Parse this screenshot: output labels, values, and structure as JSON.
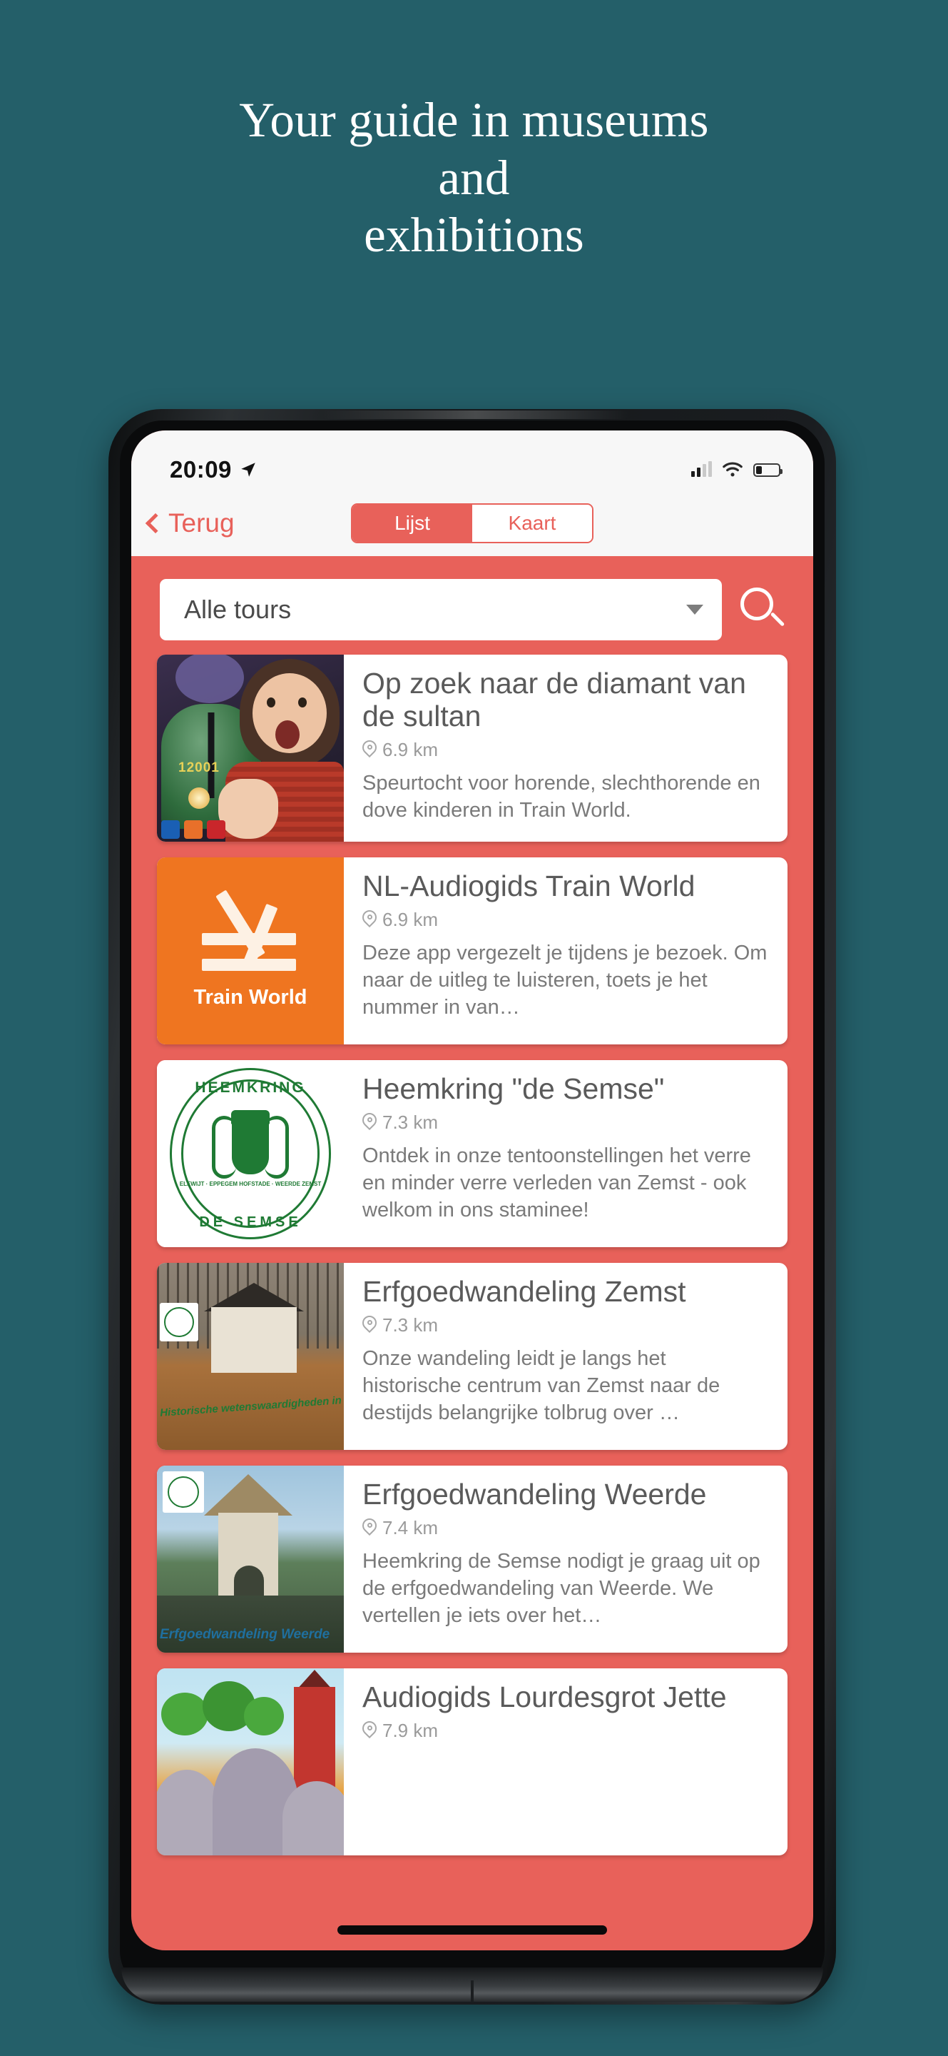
{
  "hero": {
    "line1": "Your guide in museums",
    "line2": "and",
    "line3": "exhibitions",
    "background_color": "#245f69",
    "text_color": "#ffffff"
  },
  "theme": {
    "accent_coral": "#e8615a",
    "teal": "#245f69",
    "orange": "#ef7520",
    "green": "#1f7a34"
  },
  "status_bar": {
    "time": "20:09",
    "location_icon": "location-arrow-icon",
    "signal_icon": "signal-bars-icon",
    "wifi_icon": "wifi-icon",
    "battery_icon": "battery-icon"
  },
  "nav": {
    "back_label": "Terug",
    "back_icon": "chevron-left-icon",
    "segments": [
      {
        "label": "Lijst",
        "selected": true
      },
      {
        "label": "Kaart",
        "selected": false
      }
    ]
  },
  "search": {
    "filter_value": "Alle tours",
    "dropdown_icon": "chevron-down-icon",
    "search_icon": "search-icon"
  },
  "cards": [
    {
      "title": "Op zoek naar de diamant van de sultan",
      "distance": "6.9 km",
      "distance_icon": "map-pin-icon",
      "description": "Speurtocht voor horende, slechthorende en dove kinderen in Train World.",
      "thumb": "photo-girl-locomotive",
      "thumb_number": "12001"
    },
    {
      "title": "NL-Audiogids Train World",
      "distance": "6.9 km",
      "distance_icon": "map-pin-icon",
      "description": "Deze app vergezelt je tijdens je bezoek. Om naar de uitleg te luisteren, toets je het nummer in van…",
      "thumb": "logo-train-world",
      "thumb_label": "Train World"
    },
    {
      "title": "Heemkring \"de Semse\"",
      "distance": "7.3 km",
      "distance_icon": "map-pin-icon",
      "description": "Ontdek in onze tentoonstellingen het verre en minder verre verleden van Zemst - ook welkom in ons staminee!",
      "thumb": "seal-heemkring-de-semse",
      "seal_top": "HEEMKRING",
      "seal_bottom": "DE SEMSE",
      "seal_micro": "ELEWIJT · EPPEGEM\nHOFSTADE · WEERDE\nZEMST"
    },
    {
      "title": "Erfgoedwandeling Zemst",
      "distance": "7.3 km",
      "distance_icon": "map-pin-icon",
      "description": "Onze wandeling leidt je langs het historische centrum van Zemst naar de destijds belangrijke tolbrug over …",
      "thumb": "photo-church-zemst",
      "thumb_caption": "Historische wetenswaardigheden in Zemst"
    },
    {
      "title": "Erfgoedwandeling Weerde",
      "distance": "7.4 km",
      "distance_icon": "map-pin-icon",
      "description": "Heemkring de Semse nodigt je graag uit op de erfgoedwandeling van Weerde. We vertellen je iets over het…",
      "thumb": "photo-tower-weerde",
      "thumb_caption": "Erfgoedwandeling Weerde"
    },
    {
      "title": "Audiogids Lourdesgrot Jette",
      "distance": "7.9 km",
      "distance_icon": "map-pin-icon",
      "description": "",
      "thumb": "illustration-lourdesgrot"
    }
  ]
}
